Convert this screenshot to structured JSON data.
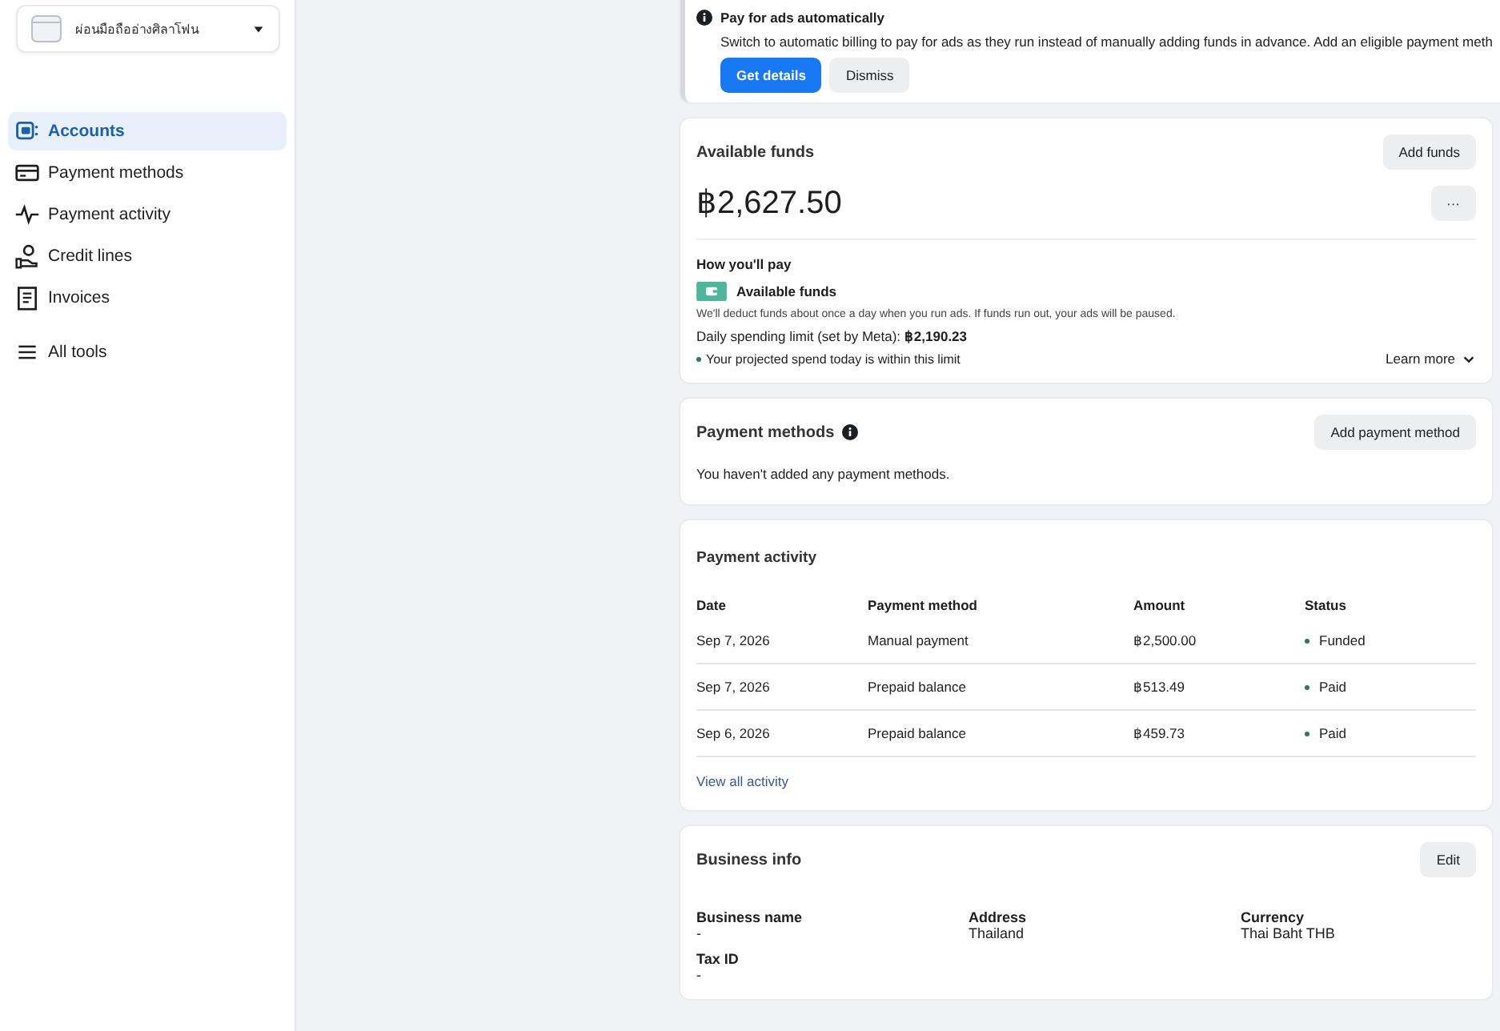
{
  "sidebar": {
    "account": {
      "name": "ผ่อนมือถืออ่างศิลาโฟน"
    },
    "items": [
      {
        "label": "Accounts",
        "selected": true
      },
      {
        "label": "Payment methods",
        "selected": false
      },
      {
        "label": "Payment activity",
        "selected": false
      },
      {
        "label": "Credit lines",
        "selected": false
      },
      {
        "label": "Invoices",
        "selected": false
      },
      {
        "label": "All tools",
        "selected": false
      }
    ]
  },
  "banner": {
    "title": "Pay for ads automatically",
    "text": "Switch to automatic billing to pay for ads as they run instead of manually adding funds in advance. Add an eligible payment meth",
    "buttons": [
      {
        "label": "Get details",
        "kind": "primary"
      },
      {
        "label": "Dismiss",
        "kind": "secondary"
      }
    ]
  },
  "available_funds": {
    "title": "Available funds",
    "button": "Add funds",
    "more": "···",
    "amount": "฿2,627.50",
    "how_title": "How you'll pay",
    "method": "Available funds",
    "note": "We'll deduct funds about once a day when you run ads. If funds run out, your ads will be paused.",
    "limit": "Daily spending limit (set by Meta): **฿2,190.23**",
    "projection": "Your projected spend today is within this limit",
    "learn_more": "Learn more"
  },
  "payment_methods": {
    "title": "Payment methods",
    "button": "Add payment method",
    "empty": "You haven't added any payment methods."
  },
  "payment_activity": {
    "title": "Payment activity",
    "columns": [
      "Date",
      "Payment method",
      "Amount",
      "Status"
    ],
    "rows": [
      {
        "date": "Sep 7, 2026",
        "method": "Manual payment",
        "amount": "฿2,500.00",
        "status": "Funded"
      },
      {
        "date": "Sep 7, 2026",
        "method": "Prepaid balance",
        "amount": "฿513.49",
        "status": "Paid"
      },
      {
        "date": "Sep 6, 2026",
        "method": "Prepaid balance",
        "amount": "฿459.73",
        "status": "Paid"
      }
    ],
    "link": "View all activity"
  },
  "business_info": {
    "title": "Business info",
    "button": "Edit",
    "fields": [
      {
        "label": "Business name",
        "value": "-"
      },
      {
        "label": "Address",
        "value": "Thailand"
      },
      {
        "label": "Currency",
        "value": "Thai Baht THB"
      },
      {
        "label": "Tax ID",
        "value": "-"
      }
    ]
  }
}
